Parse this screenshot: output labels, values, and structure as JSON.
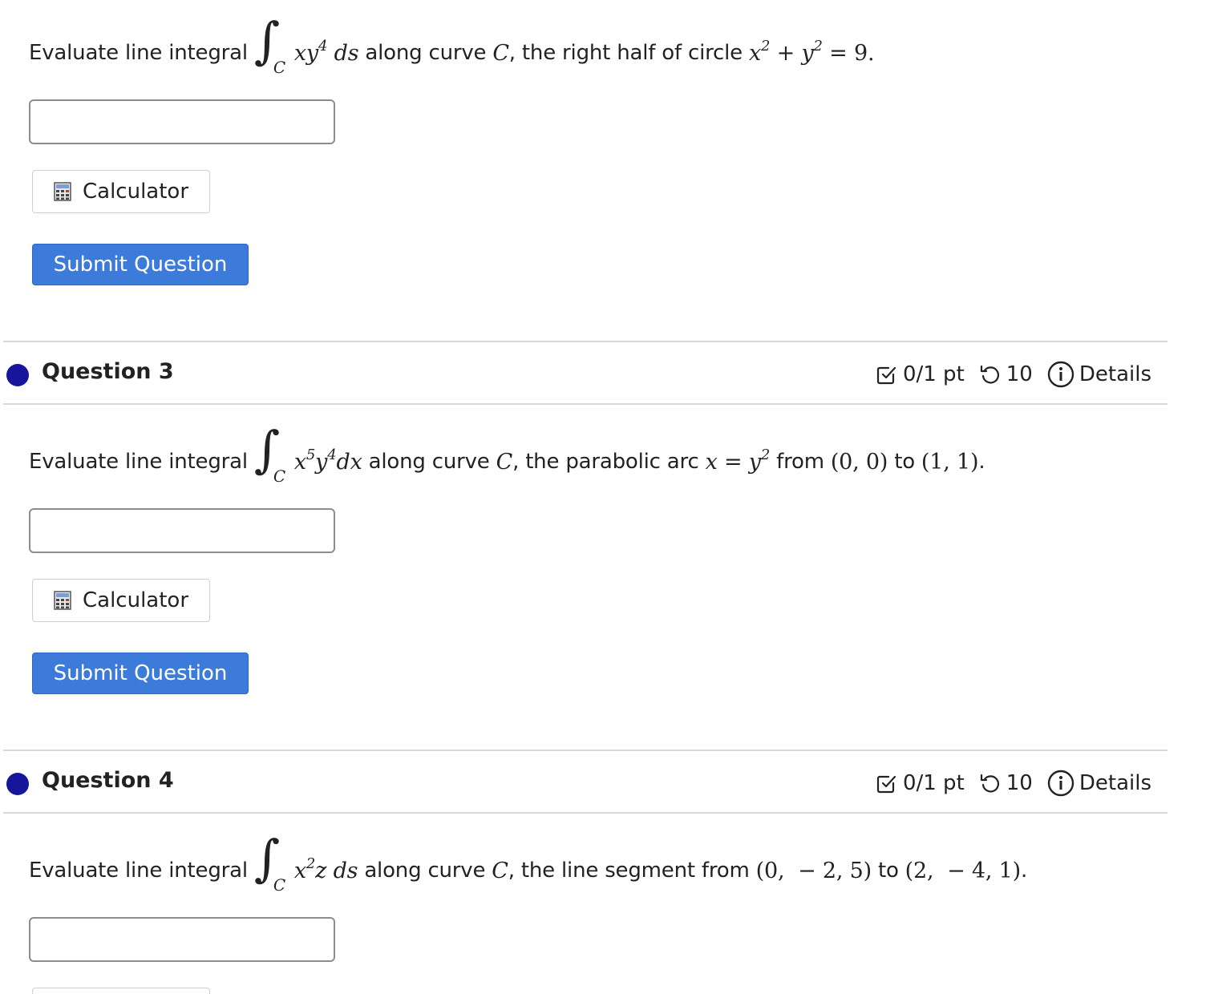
{
  "questions": [
    {
      "prompt_prefix": "Evaluate line integral",
      "integral_sub": "C",
      "integrand": {
        "a": "xy",
        "a_sup": "4",
        "b": " ds"
      },
      "mid": "along curve",
      "curve": "C",
      "desc": ", the right half of circle",
      "tail": {
        "x": "x",
        "x_sup": "2",
        "plus": " + ",
        "y": "y",
        "y_sup": "2",
        "eq": " = 9."
      },
      "answer_value": "",
      "calculator_label": "Calculator",
      "submit_label": "Submit Question"
    },
    {
      "title": "Question 3",
      "score": "0/1 pt",
      "attempts": "10",
      "details_label": "Details",
      "prompt_prefix": "Evaluate line integral",
      "integral_sub": "C",
      "integrand": {
        "x": "x",
        "x_sup": "5",
        "y": "y",
        "y_sup": "4",
        "d": "dx"
      },
      "mid": "along curve",
      "curve": "C",
      "desc": ", the parabolic arc",
      "tail": {
        "eqn": "x = y",
        "eqn_sup": "2",
        "from": "from",
        "p1": "(0, 0)",
        "to": "to",
        "p2": "(1, 1)",
        "end": "."
      },
      "answer_value": "",
      "calculator_label": "Calculator",
      "submit_label": "Submit Question"
    },
    {
      "title": "Question 4",
      "score": "0/1 pt",
      "attempts": "10",
      "details_label": "Details",
      "prompt_prefix": "Evaluate line integral",
      "integral_sub": "C",
      "integrand": {
        "x": "x",
        "x_sup": "2",
        "rest": "z ds"
      },
      "mid": "along curve",
      "curve": "C",
      "desc": ", the line segment from",
      "tail": {
        "p1": "(0,  − 2, 5)",
        "to": "to",
        "p2": "(2,  − 4, 1)",
        "end": "."
      },
      "answer_value": ""
    }
  ],
  "colors": {
    "dot": "#15169a",
    "submit_bg": "#3c7bd9",
    "divider": "#d8d8d8"
  },
  "icons": {
    "calculator": "calculator-icon",
    "score": "checkbox-check-icon",
    "attempts": "retry-arrow-icon",
    "details": "info-circle-icon"
  }
}
